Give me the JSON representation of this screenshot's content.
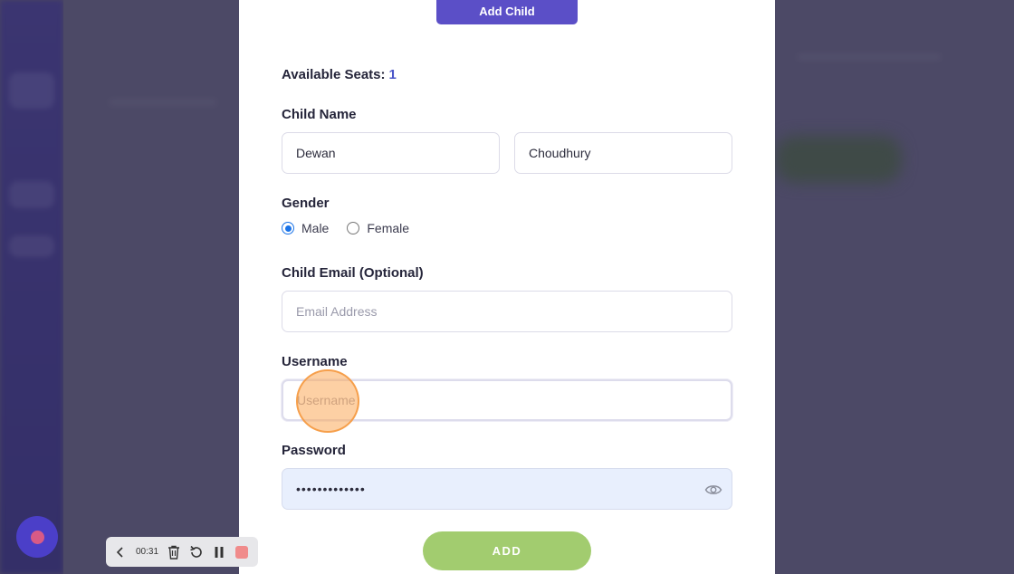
{
  "header": {
    "add_child_label": "Add Child"
  },
  "seats": {
    "label": "Available Seats:",
    "value": "1"
  },
  "child_name": {
    "label": "Child Name",
    "first_value": "Dewan",
    "last_value": "Choudhury"
  },
  "gender": {
    "label": "Gender",
    "options": [
      {
        "label": "Male",
        "checked": true
      },
      {
        "label": "Female",
        "checked": false
      }
    ]
  },
  "email": {
    "label": "Child Email (Optional)",
    "placeholder": "Email Address"
  },
  "username": {
    "label": "Username",
    "placeholder": "Username"
  },
  "password": {
    "label": "Password",
    "value": "•••••••••••••"
  },
  "submit": {
    "label": "ADD"
  },
  "recorder": {
    "time": "00:31"
  },
  "colors": {
    "accent": "#5b4fc7",
    "add_button": "#a2cc6f",
    "radio_checked": "#1a73e8",
    "click_marker": "#fbaa5a"
  }
}
